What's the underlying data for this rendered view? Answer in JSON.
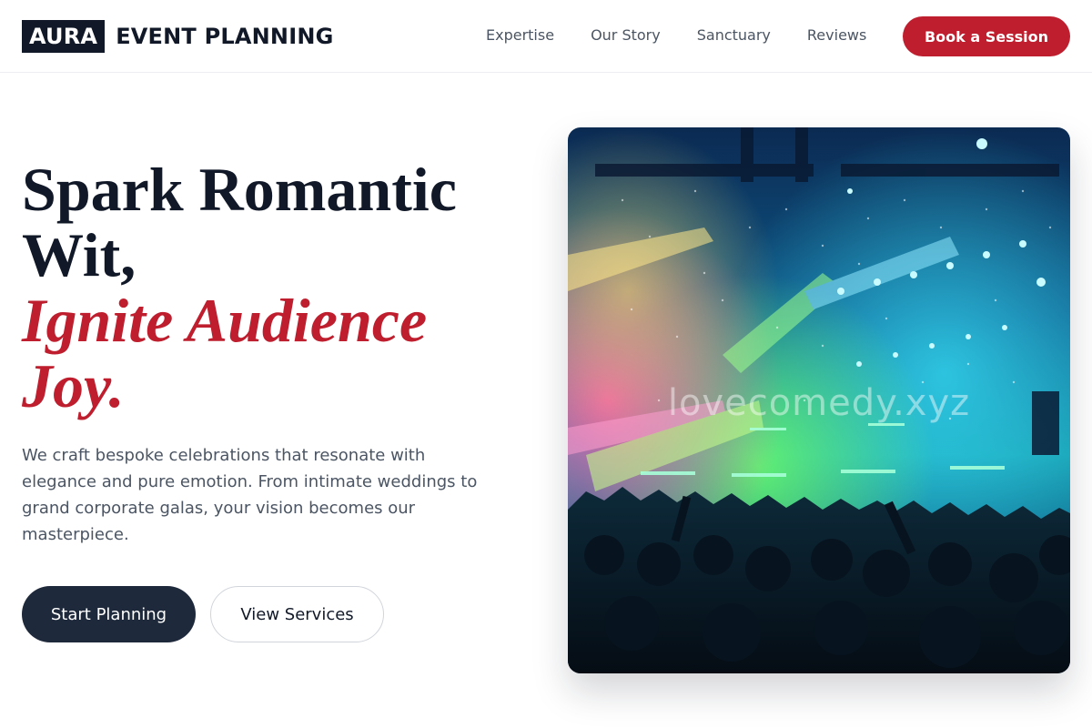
{
  "brand": {
    "logo_mark": "AURA",
    "logo_text": "EVENT PLANNING"
  },
  "nav": {
    "links": [
      "Expertise",
      "Our Story",
      "Sanctuary",
      "Reviews"
    ],
    "cta": "Book a Session"
  },
  "hero": {
    "headline_line1": "Spark Romantic",
    "headline_line2": "Wit,",
    "headline_accent_line1": "Ignite Audience",
    "headline_accent_line2": "Joy.",
    "lead": "We craft bespoke celebrations that resonate with elegance and pure emotion. From intimate weddings to grand corporate galas, your vision becomes our masterpiece.",
    "primary_button": "Start Planning",
    "secondary_button": "View Services",
    "image_watermark": "lovecomedy.xyz"
  },
  "colors": {
    "accent": "#be1e2d",
    "dark": "#111827",
    "button_dark": "#1e293b",
    "body_text": "#4b5563"
  }
}
